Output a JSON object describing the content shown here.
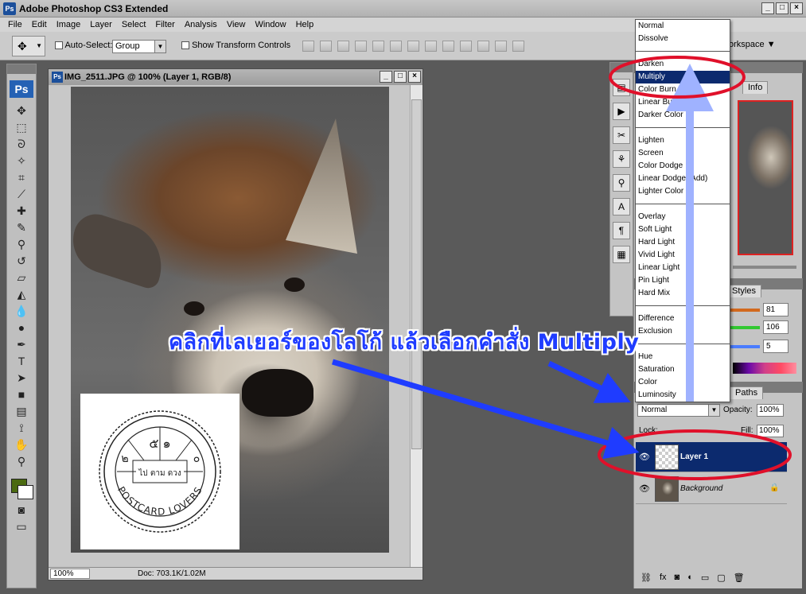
{
  "app": {
    "title": "Adobe Photoshop CS3 Extended",
    "icon": "Ps"
  },
  "menu": [
    "File",
    "Edit",
    "Image",
    "Layer",
    "Select",
    "Filter",
    "Analysis",
    "View",
    "Window",
    "Help"
  ],
  "options_bar": {
    "auto_select_label": "Auto-Select:",
    "auto_select_value": "Group",
    "show_transform_label": "Show Transform Controls",
    "workspace_label": "orkspace ▼"
  },
  "document": {
    "title": "IMG_2511.JPG @ 100% (Layer 1, RGB/8)",
    "zoom": "100%",
    "doc_size": "Doc: 703.1K/1.02M"
  },
  "stamp": {
    "top_digits": "๕   ๑",
    "left_digit": "๒",
    "right_digit": "๐",
    "center_text": "ไป ตาม ดวง",
    "ring_text": "POSTCARD LOVERS"
  },
  "panels": {
    "tab_info": "Info",
    "tab_styles": "Styles",
    "tab_paths": "Paths",
    "color_values": [
      "81",
      "106",
      "5"
    ],
    "blend_mode": "Normal",
    "opacity_label": "Opacity:",
    "opacity_value": "100%",
    "lock_label": "Lock:",
    "fill_label": "Fill:",
    "fill_value": "100%",
    "layers": [
      {
        "name": "Layer 1"
      },
      {
        "name": "Background"
      }
    ]
  },
  "blend_menu": {
    "groups": [
      [
        "Normal",
        "Dissolve"
      ],
      [
        "Darken",
        "Multiply",
        "Color Burn",
        "Linear Burn",
        "Darker Color"
      ],
      [
        "Lighten",
        "Screen",
        "Color Dodge",
        "Linear Dodge (Add)",
        "Lighter Color"
      ],
      [
        "Overlay",
        "Soft Light",
        "Hard Light",
        "Vivid Light",
        "Linear Light",
        "Pin Light",
        "Hard Mix"
      ],
      [
        "Difference",
        "Exclusion"
      ],
      [
        "Hue",
        "Saturation",
        "Color",
        "Luminosity"
      ]
    ],
    "selected": "Multiply"
  },
  "annotation": {
    "caption": "คลิกที่เลเยอร์ของโลโก้ แล้วเลือกคำสั่ง Multiply"
  },
  "colors": {
    "selection": "#0c2a6e",
    "foreground": "#4b6a10",
    "annotation_red": "#e0102a",
    "annotation_blue": "#1f3cff"
  }
}
